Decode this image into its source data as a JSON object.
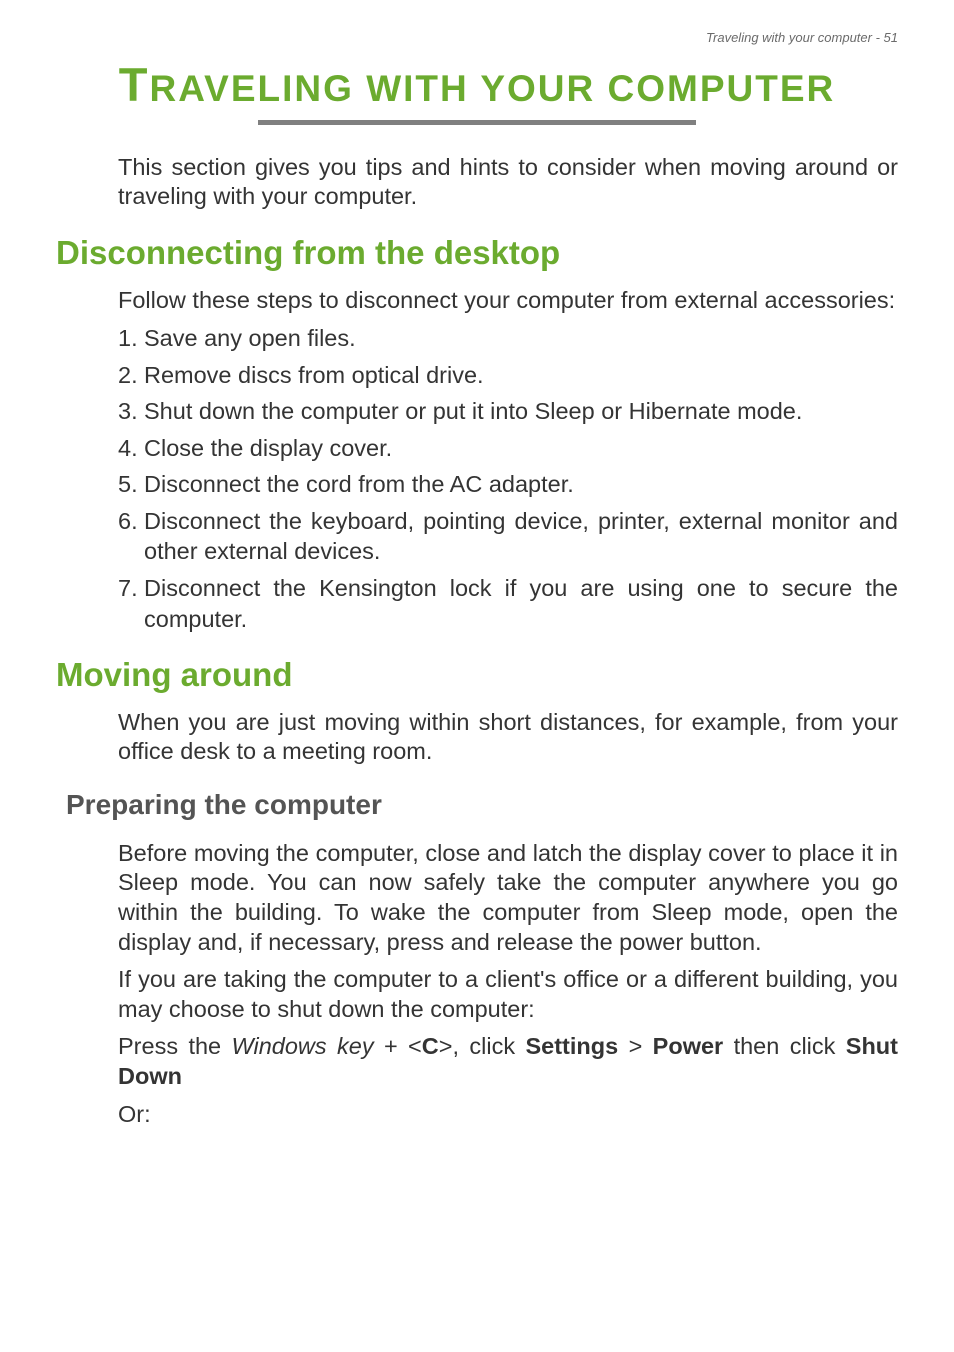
{
  "header": {
    "running_head": "Traveling with your computer - 51"
  },
  "title": {
    "first_char": "T",
    "rest": "RAVELING WITH YOUR COMPUTER"
  },
  "intro": "This section gives you tips and hints to consider when moving around or traveling with your computer.",
  "section_disconnect": {
    "heading": "Disconnecting from the desktop",
    "intro": "Follow these steps to disconnect your computer from external accessories:",
    "items": [
      "Save any open files.",
      "Remove discs from optical drive.",
      "Shut down the computer or put it into Sleep or Hibernate mode.",
      "Close the display cover.",
      "Disconnect the cord from the AC adapter.",
      "Disconnect the keyboard, pointing device, printer, external monitor and other external devices.",
      "Disconnect the Kensington lock if you are using one to secure the computer."
    ]
  },
  "section_moving": {
    "heading": "Moving around",
    "intro": "When you are just moving within short distances, for example, from your office desk to a meeting room."
  },
  "section_preparing": {
    "heading": "Preparing the computer",
    "para1": "Before moving the computer, close and latch the display cover to place it in Sleep mode. You can now safely take the computer anywhere you go within the building. To wake the computer from Sleep mode, open the display and, if necessary, press and release the power button.",
    "para2": "If you are taking the computer to a client's office or a different building, you may choose to shut down the computer:",
    "press_prefix": "Press the ",
    "windows_key": "Windows key",
    "plus_open": " + <",
    "key_c": "C",
    "close_click": ">, click ",
    "settings": "Settings",
    "gt": " > ",
    "power": "Power",
    "then_click": " then click ",
    "shut_down": "Shut Down",
    "or_label": "Or:"
  }
}
